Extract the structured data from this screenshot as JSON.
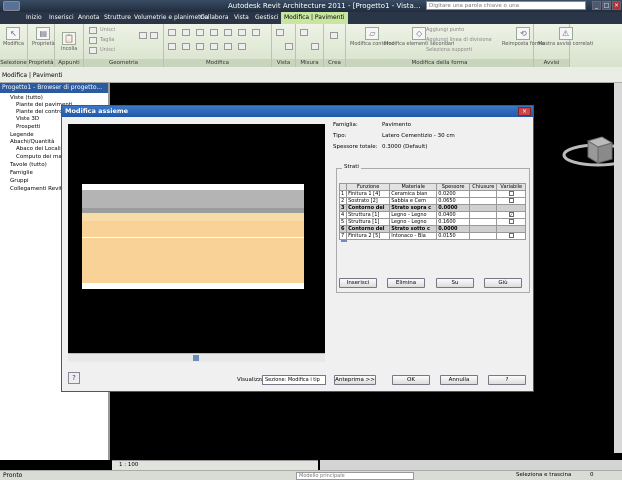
{
  "window": {
    "title": "Autodesk Revit Architecture 2011 - [Progetto1 - Vista...",
    "search_placeholder": "Digitare una parola chiave o una",
    "controls": [
      "_",
      "□",
      "×"
    ]
  },
  "menu_tabs": [
    "Inizio",
    "Inserisci",
    "Annota",
    "Strutture",
    "Volumetrie e planimetria",
    "Collabora",
    "Vista",
    "Gestisci",
    "Modifica | Pavimenti"
  ],
  "ribbon": {
    "groups": [
      "Selezione",
      "Proprietà",
      "Appunti",
      "Geometria",
      "Modifica",
      "Vista",
      "Misura",
      "Crea",
      "Modifica della forma"
    ],
    "items": {
      "modify": "Modifica",
      "properties": "Proprietà",
      "paste": "Incolla",
      "cope": "Unisci",
      "cut": "Taglia",
      "join": "Unisci",
      "modify_contour": "Modifica contorno",
      "modify_sub": "Modifica elementi secondari",
      "add_point": "Aggiungi punto",
      "add_split": "Aggiungi linea di divisione",
      "select_supports": "Seleziona supporti",
      "reset_shape": "Reimposta forma",
      "show_related": "Mostra avvisi correlati"
    },
    "extra_group": "Avvisi"
  },
  "options_bar": "Modifica | Pavimenti",
  "browser": {
    "title": "Progetto1 - Browser di progetto...",
    "items": [
      "Viste (tutto)",
      "Piante dei pavimenti",
      "Piante dei controsoffitti",
      "Viste 3D",
      "Prospetti",
      "Legende",
      "Abachi/Quantità",
      "Abaco dei Locali",
      "Computo dei materiali",
      "Tavole (tutto)",
      "Famiglie",
      "Gruppi",
      "Collegamenti Revit"
    ]
  },
  "dialog": {
    "title": "Modifica assieme",
    "family_label": "Famiglia:",
    "family_value": "Pavimento",
    "type_label": "Tipo:",
    "type_value": "Latero Cementizio - 30 cm",
    "thickness_label": "Spessore totale:",
    "thickness_value": "0.3000 (Default)",
    "layers_label": "Strati",
    "columns": [
      "Funzione",
      "Materiale",
      "Spessore",
      "Chiusure",
      "Variabile"
    ],
    "layers": [
      {
        "n": "1",
        "function": "Finitura 1 [4]",
        "material": "Ceramica bian",
        "thickness": "0.0200",
        "var": false,
        "core": false
      },
      {
        "n": "2",
        "function": "Sostrato [2]",
        "material": "Sabbia e Cem",
        "thickness": "0.0650",
        "var": false,
        "core": false
      },
      {
        "n": "3",
        "function": "Contorno del",
        "material": "Strato sopra c",
        "thickness": "0.0000",
        "var": false,
        "core": true
      },
      {
        "n": "4",
        "function": "Struttura [1]",
        "material": "Legno - Legno",
        "thickness": "0.0400",
        "var": true,
        "core": false
      },
      {
        "n": "5",
        "function": "Struttura [1]",
        "material": "Legno - Legno",
        "thickness": "0.1600",
        "var": false,
        "core": false
      },
      {
        "n": "6",
        "function": "Contorno del",
        "material": "Strato sotto c",
        "thickness": "0.0000",
        "var": false,
        "core": true
      },
      {
        "n": "7",
        "function": "Finitura 2 [5]",
        "material": "Intonaco - Bia",
        "thickness": "0.0150",
        "var": false,
        "core": false
      }
    ],
    "buttons": {
      "insert": "Inserisci",
      "delete": "Elimina",
      "up": "Su",
      "down": "Giù"
    },
    "view_label": "Visualizza:",
    "view_value": "Sezione: Modifica i tip",
    "preview_btn": "Anteprima >>",
    "ok": "OK",
    "cancel": "Annulla",
    "help": "?"
  },
  "view_bar": {
    "scale": "1 : 100"
  },
  "status": {
    "text": "Pronto",
    "model": "Modello principale",
    "drag": "Seleziona e trascina",
    "filter": "0"
  }
}
